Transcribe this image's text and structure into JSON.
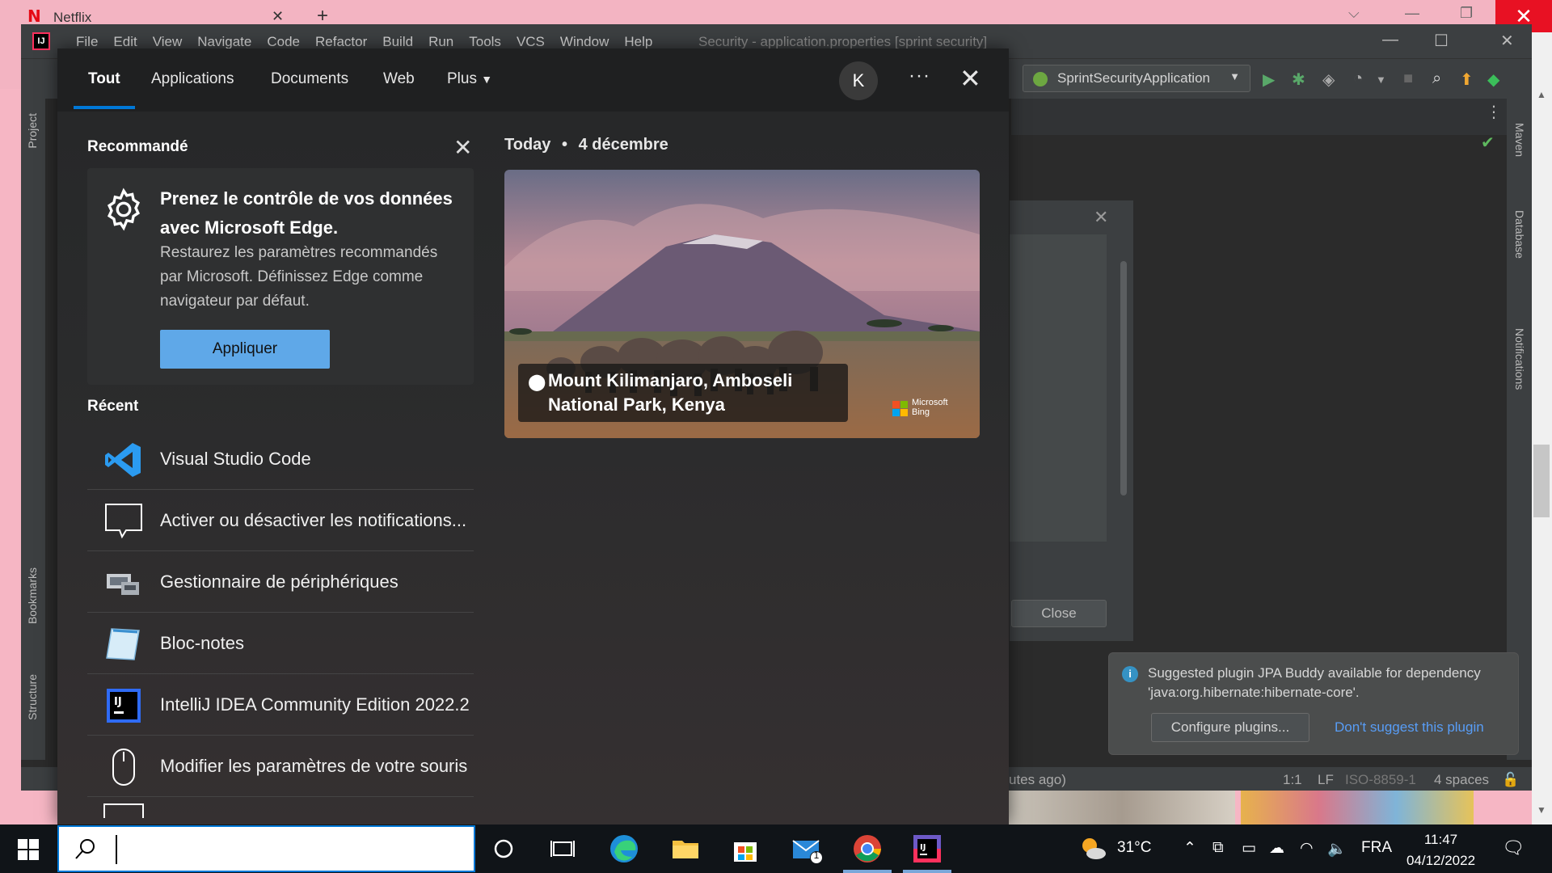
{
  "browser": {
    "tab_title": "Netflix"
  },
  "ide": {
    "menu": [
      "File",
      "Edit",
      "View",
      "Navigate",
      "Code",
      "Refactor",
      "Build",
      "Run",
      "Tools",
      "VCS",
      "Window",
      "Help"
    ],
    "window_title": "Security - application.properties [sprint security]",
    "run_config": "SprintSecurityApplication",
    "left_tabs": {
      "project": "Project",
      "bookmarks": "Bookmarks",
      "structure": "Structure"
    },
    "right_tabs": {
      "maven": "Maven",
      "database": "Database",
      "notifications": "Notifications"
    },
    "dialog_close": "Close",
    "notification": {
      "message": "Suggested plugin JPA Buddy available for dependency 'java:org.hibernate:hibernate-core'.",
      "configure": "Configure plugins...",
      "dont_suggest": "Don't suggest this plugin"
    },
    "status": {
      "left_text": "utes ago)",
      "position": "1:1",
      "line_sep": "LF",
      "encoding": "ISO-8859-1",
      "indent": "4 spaces"
    }
  },
  "search": {
    "tabs": [
      "Tout",
      "Applications",
      "Documents",
      "Web",
      "Plus"
    ],
    "avatar_letter": "K",
    "recommended": {
      "title": "Recommandé",
      "heading": "Prenez le contrôle de vos données avec Microsoft Edge.",
      "body": "Restaurez les paramètres recommandés par Microsoft. Définissez Edge comme navigateur par défaut.",
      "button": "Appliquer"
    },
    "recent_title": "Récent",
    "recent": [
      {
        "label": "Visual Studio Code",
        "icon": "vscode-icon"
      },
      {
        "label": "Activer ou désactiver les notifications...",
        "icon": "notification-icon"
      },
      {
        "label": "Gestionnaire de périphériques",
        "icon": "device-manager-icon"
      },
      {
        "label": "Bloc-notes",
        "icon": "notepad-icon"
      },
      {
        "label": "IntelliJ IDEA Community Edition 2022.2",
        "icon": "intellij-icon"
      },
      {
        "label": "Modifier les paramètres de votre souris",
        "icon": "mouse-icon"
      }
    ],
    "today_label": "Today",
    "today_date": "4 décembre",
    "photo_caption": "Mount Kilimanjaro, Amboseli National Park, Kenya",
    "bing_label_1": "Microsoft",
    "bing_label_2": "Bing"
  },
  "taskbar": {
    "search_placeholder": "",
    "weather": "31°C",
    "language": "FRA",
    "time": "11:47",
    "date": "04/12/2022",
    "mail_badge": "1"
  },
  "colors": {
    "accent": "#0078d7",
    "apply_button": "#5fa8e8",
    "link": "#589df6"
  }
}
